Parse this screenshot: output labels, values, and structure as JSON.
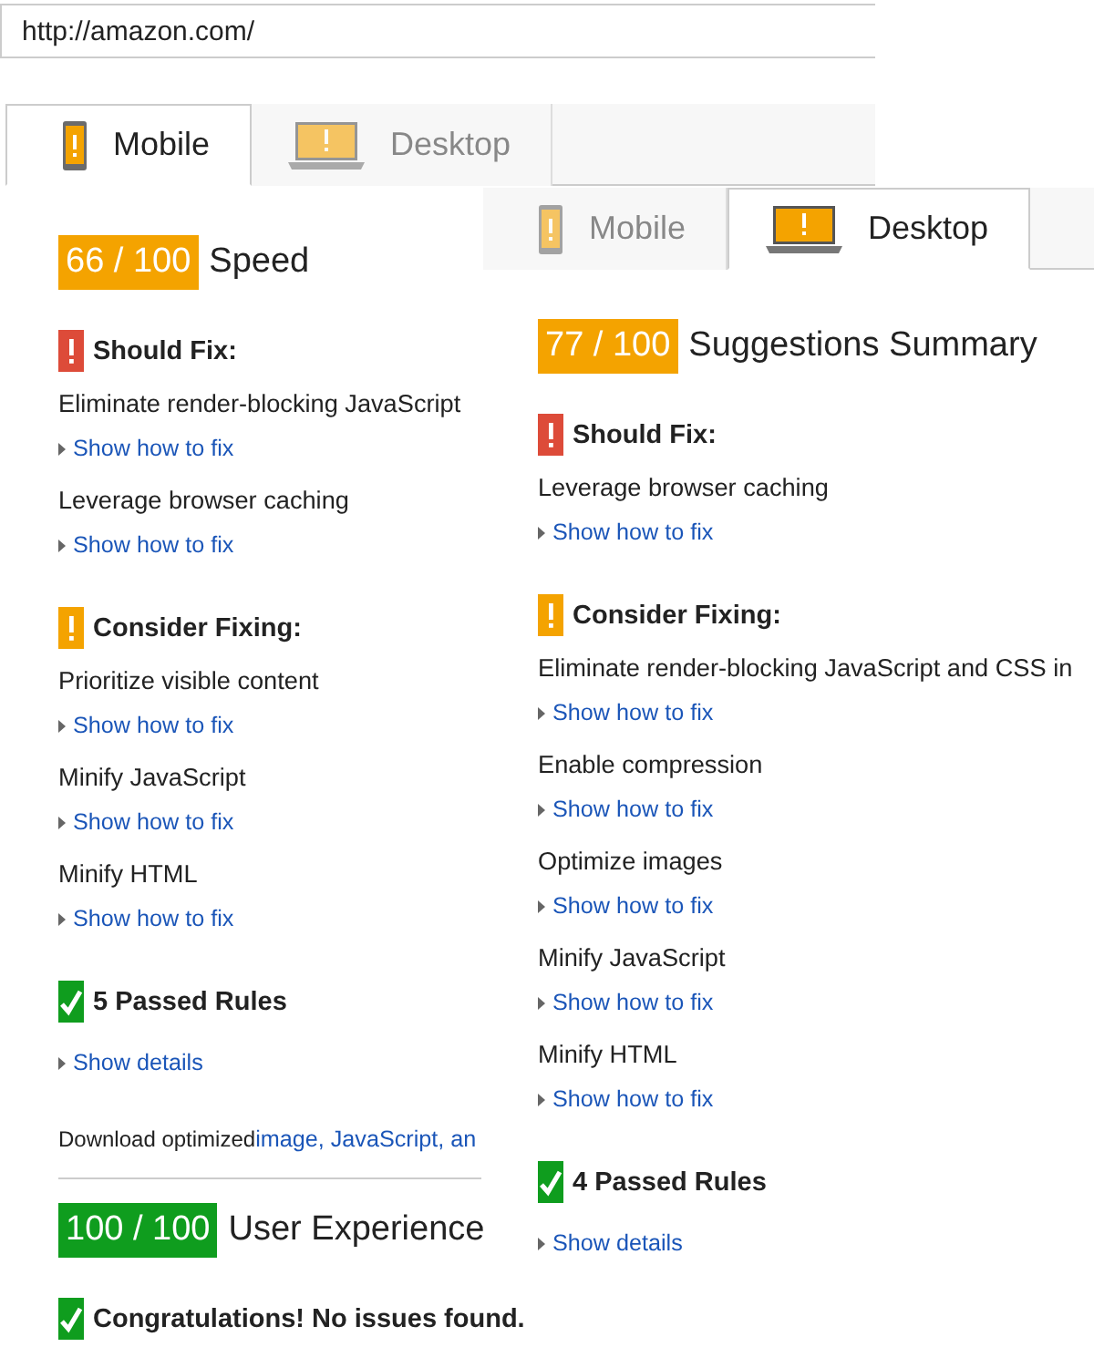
{
  "url_field": {
    "value": "http://amazon.com/"
  },
  "panels": [
    {
      "tabs": [
        {
          "label": "Mobile",
          "kind": "mobile",
          "selected": true
        },
        {
          "label": "Desktop",
          "kind": "desktop",
          "selected": false
        }
      ],
      "blocks": [
        {
          "kind": "score",
          "value": "66 / 100",
          "color": "#f4a300",
          "title": "Speed"
        },
        {
          "kind": "should",
          "title": "Should Fix:",
          "items": [
            {
              "title": "Eliminate render-blocking JavaScript",
              "link": "Show how to fix"
            },
            {
              "title": "Leverage browser caching",
              "link": "Show how to fix"
            }
          ]
        },
        {
          "kind": "consider",
          "title": "Consider Fixing:",
          "items": [
            {
              "title": "Prioritize visible content",
              "link": "Show how to fix"
            },
            {
              "title": "Minify JavaScript",
              "link": "Show how to fix"
            },
            {
              "title": "Minify HTML",
              "link": "Show how to fix"
            }
          ]
        },
        {
          "kind": "passed",
          "title": "5 Passed Rules",
          "link": "Show details"
        },
        {
          "kind": "note",
          "text": "Download optimized",
          "link": "image, JavaScript, an"
        },
        {
          "kind": "score",
          "value": "100 / 100",
          "color": "#0f9d1e",
          "title": "User Experience"
        },
        {
          "kind": "passed",
          "title": "Congratulations! No issues found."
        }
      ]
    },
    {
      "tabs": [
        {
          "label": "Mobile",
          "kind": "mobile",
          "selected": false
        },
        {
          "label": "Desktop",
          "kind": "desktop",
          "selected": true
        }
      ],
      "blocks": [
        {
          "kind": "score",
          "value": "77 / 100",
          "color": "#f4a300",
          "title": "Suggestions Summary"
        },
        {
          "kind": "should",
          "title": "Should Fix:",
          "items": [
            {
              "title": "Leverage browser caching",
              "link": "Show how to fix"
            }
          ]
        },
        {
          "kind": "consider",
          "title": "Consider Fixing:",
          "items": [
            {
              "title": "Eliminate render-blocking JavaScript and CSS in",
              "link": "Show how to fix"
            },
            {
              "title": "Enable compression",
              "link": "Show how to fix"
            },
            {
              "title": "Optimize images",
              "link": "Show how to fix"
            },
            {
              "title": "Minify JavaScript",
              "link": "Show how to fix"
            },
            {
              "title": "Minify HTML",
              "link": "Show how to fix"
            }
          ]
        },
        {
          "kind": "passed",
          "title": "4 Passed Rules",
          "link": "Show details"
        }
      ]
    }
  ]
}
